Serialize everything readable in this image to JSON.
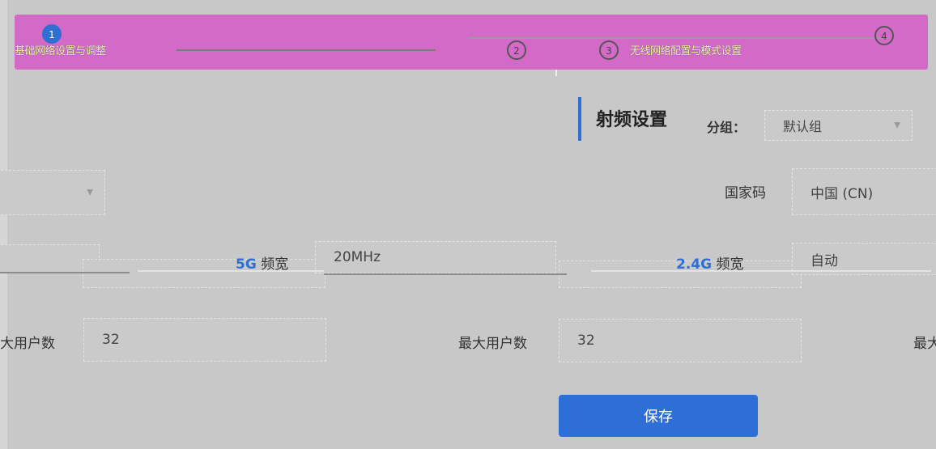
{
  "banner": {
    "step1_text": "基础网络设置与调整",
    "step2_num": "2",
    "step3_num": "3",
    "step3_text": "无线网络配置与模式设置"
  },
  "radio": {
    "title": "射频设置",
    "group_label": "分组：",
    "group_value": "默认组",
    "country_label": "国家码",
    "country_value": "中国 (CN)",
    "band5g_prefix": "5G",
    "band5g_suffix": " 频宽",
    "band5g_value": "20MHz",
    "band24_prefix": "2.4G",
    "band24_suffix": " 频宽",
    "band24_value": "自动",
    "maxusers_left_label": "大用户数",
    "maxusers_left_value": "32",
    "maxusers_mid_label": "最大用户数",
    "maxusers_mid_value": "32",
    "maxusers_right_label": "最大",
    "save": "保存"
  }
}
